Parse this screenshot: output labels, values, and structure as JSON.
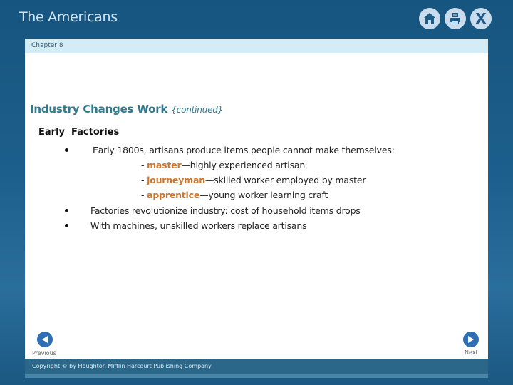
{
  "app": {
    "title": "The Americans",
    "icons": [
      "home-icon",
      "print-icon",
      "close-icon"
    ],
    "close_glyph": "X"
  },
  "chapter": {
    "label": "Chapter 8"
  },
  "slide": {
    "title": "Industry Changes Work",
    "title_suffix": "{continued}",
    "section_heading": "Early  Factories",
    "bullets": [
      {
        "text": "Early 1800s, artisans produce items people cannot make themselves:",
        "sub_items": [
          {
            "prefix": "- ",
            "term": "master",
            "desc": "—highly experienced artisan"
          },
          {
            "prefix": "- ",
            "term": "journeyman",
            "desc": "—skilled worker employed by master"
          },
          {
            "prefix": "- ",
            "term": "apprentice",
            "desc": "—young worker learning craft"
          }
        ]
      },
      {
        "text": "Factories revolutionize industry: cost of household items drops"
      },
      {
        "text": "With machines, unskilled workers replace artisans"
      }
    ]
  },
  "navigation": {
    "previous_label": "Previous",
    "next_label": "Next"
  },
  "footer": {
    "copyright": "Copyright © by Houghton Mifflin Harcourt Publishing Company"
  },
  "colors": {
    "title_accent": "#2f7a8e",
    "term_accent": "#d0762a",
    "nav_button": "#2f6fb3",
    "chapter_bar": "#d3ecf6",
    "background": "#1d5f8c"
  }
}
